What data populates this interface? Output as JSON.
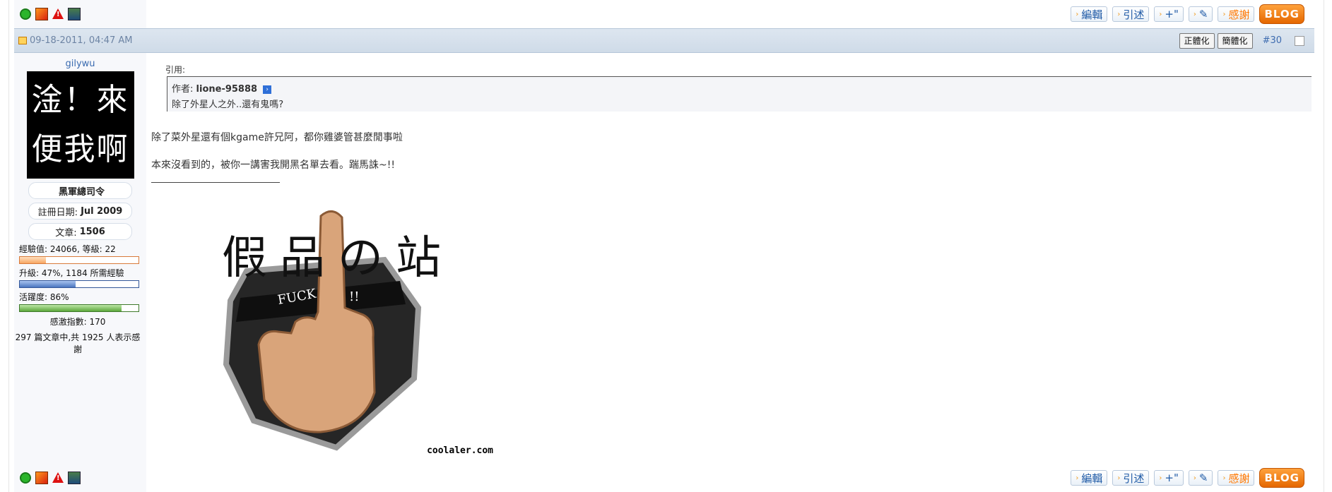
{
  "toolbar": {
    "edit": "編輯",
    "quote": "引述",
    "multiquote": "+\"",
    "thanks": "感謝",
    "blog": "BLOG"
  },
  "post": {
    "date": "09-18-2011, 04:47 AM",
    "convert_traditional": "正體化",
    "convert_simplified": "簡體化",
    "number": "#30"
  },
  "user": {
    "name": "gilywu",
    "avatar_text": "淦！來便我啊",
    "title": "黑軍總司令",
    "join_label": "註冊日期:",
    "join_value": "Jul 2009",
    "posts_label": "文章:",
    "posts_value": "1506",
    "exp_line": "經驗值: 24066, 等級: 22",
    "exp_percent": 22,
    "upgrade_line": "升級: 47%, 1184 所需經驗",
    "upgrade_percent": 47,
    "activity_line": "活躍度: 86%",
    "activity_percent": 86,
    "thanks_index": "感激指數: 170",
    "thanks_summary": "297 篇文章中,共 1925 人表示感謝"
  },
  "content": {
    "quote_label": "引用:",
    "quote_author_prefix": "作者:",
    "quote_author": "lione-95888",
    "quote_text": "除了外星人之外..還有鬼嗎?",
    "paragraph1": "除了菜外星還有個kgame許兄阿，都你雞婆管甚麼閒事啦",
    "paragraph2": "本來沒看到的，被你一講害我開黑名單去看。踹馬誅~!!",
    "sig_title": "假品の站",
    "sig_badge": "FUCK",
    "sig_badge_marks": "!!",
    "sig_credit": "coolaler.com"
  },
  "colors": {
    "header_bg": "#cfdbe8",
    "link": "#1f5aa6",
    "accent_orange": "#ff7700",
    "exp_bar": "#f7a663",
    "upgrade_bar": "#4a76c0",
    "activity_bar": "#5da83b"
  },
  "icons": [
    "online-status-icon",
    "profile-icon",
    "report-icon",
    "book-icon",
    "arrow-icon"
  ]
}
